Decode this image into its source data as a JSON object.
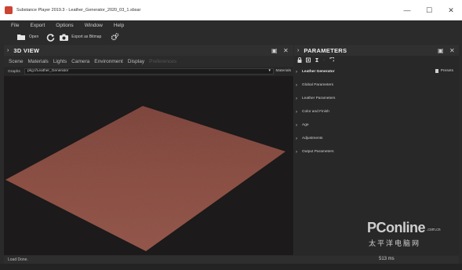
{
  "window": {
    "title": "Substance Player 2019.3 - Leather_Generator_2020_03_1.sbsar",
    "controls": {
      "minimize": "—",
      "maximize": "☐",
      "close": "✕"
    }
  },
  "menu": [
    "File",
    "Export",
    "Options",
    "Window",
    "Help"
  ],
  "toolbar": {
    "open_label": "Open",
    "export_label": "Export as Bitmap"
  },
  "view3d": {
    "title": "3D VIEW",
    "tabs": [
      "Scene",
      "Materials",
      "Lights",
      "Camera",
      "Environment",
      "Display",
      "Preferences"
    ],
    "graphs_label": "Graphs",
    "graph_value": "pkg://Leather_Generator",
    "materials_label": "Materials"
  },
  "parameters": {
    "title": "PARAMETERS",
    "presets_label": "Presets",
    "sections": [
      "Leather Generator",
      "Global Parameters",
      "Leather Parameters",
      "Color and Finish",
      "Age",
      "Adjustments",
      "Output Parameters"
    ]
  },
  "status": {
    "text": "Load Done.",
    "timing": "513 ms"
  },
  "watermark": {
    "brand": "PConline",
    "domain": ".com.cn",
    "chinese": "太平洋电脑网"
  },
  "colors": {
    "panel_bg": "#282828",
    "viewport_bg": "#1c1a1a",
    "leather": "#8a4a3c"
  }
}
